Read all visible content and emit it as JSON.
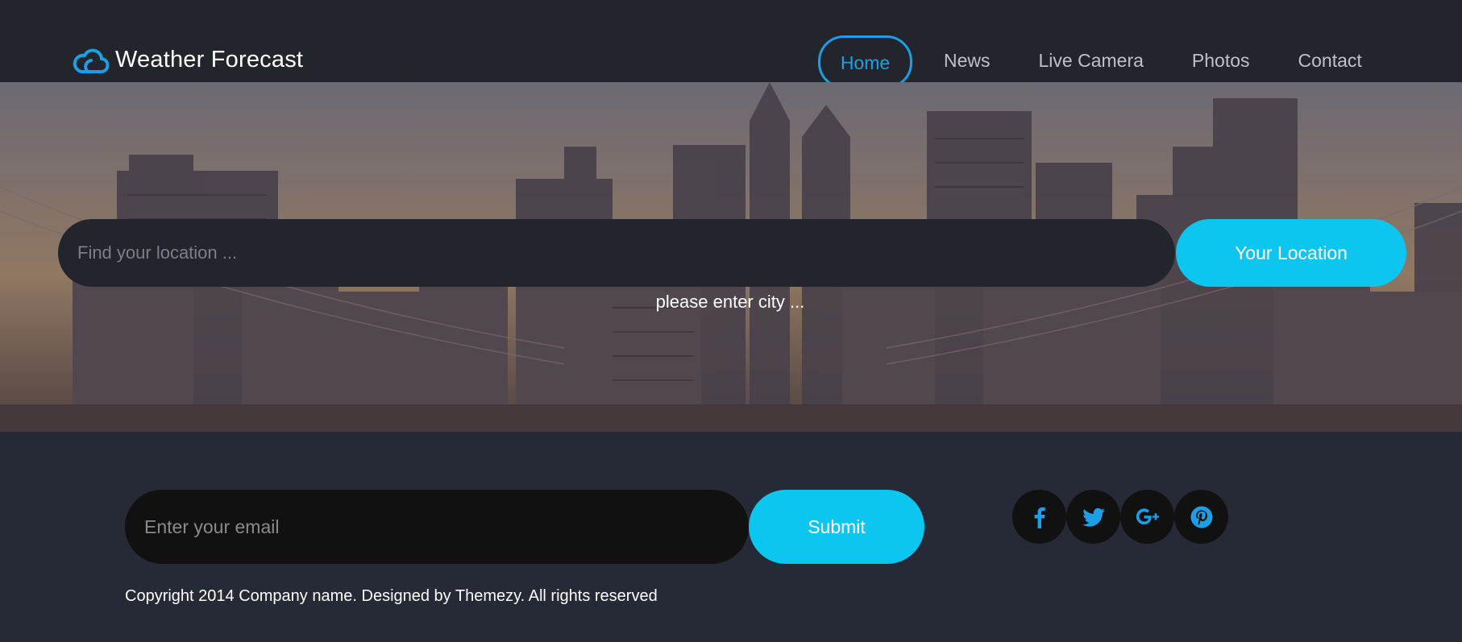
{
  "brand": {
    "title": "Weather Forecast",
    "icon": "cloud-icon"
  },
  "nav": {
    "items": [
      {
        "label": "Home",
        "active": true
      },
      {
        "label": "News",
        "active": false
      },
      {
        "label": "Live Camera",
        "active": false
      },
      {
        "label": "Photos",
        "active": false
      },
      {
        "label": "Contact",
        "active": false
      }
    ]
  },
  "hero": {
    "search_placeholder": "Find your location ...",
    "location_button_label": "Your Location",
    "hint": "please enter city ..."
  },
  "footer": {
    "email_placeholder": "Enter your email",
    "submit_label": "Submit",
    "social": [
      {
        "icon": "facebook-icon"
      },
      {
        "icon": "twitter-icon"
      },
      {
        "icon": "google-plus-icon"
      },
      {
        "icon": "pinterest-icon"
      }
    ],
    "copyright": "Copyright 2014 Company name. Designed by Themezy. All rights reserved"
  },
  "colors": {
    "accent": "#0dc6ef",
    "nav_active": "#1c9fe6",
    "header_bg": "#23252c",
    "footer_bg": "#262936"
  }
}
